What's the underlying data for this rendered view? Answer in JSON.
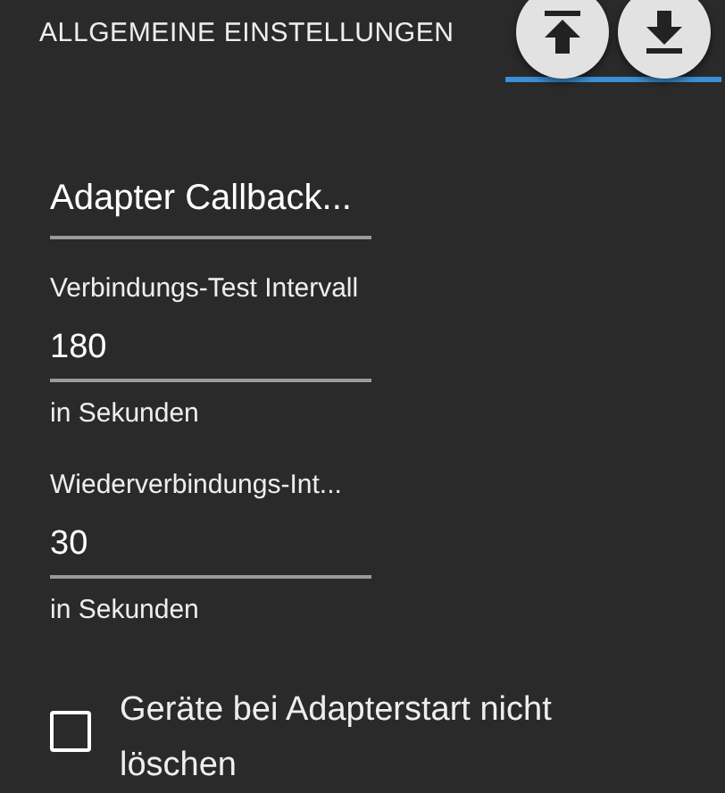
{
  "tabs": [
    {
      "label": "ALLGEMEINE EINSTELLUNGEN",
      "selected": false
    },
    {
      "selected": true
    }
  ],
  "header_buttons": [
    {
      "kind": "upload"
    },
    {
      "kind": "download"
    }
  ],
  "fields": [
    {
      "kind": "value_only",
      "value": "Adapter Callback..."
    },
    {
      "kind": "labeled",
      "label": "Verbindungs-Test Intervall",
      "value": "180",
      "helper": "in Sekunden"
    },
    {
      "kind": "labeled",
      "label": "Wiederverbindungs-Int...",
      "value": "30",
      "helper": "in Sekunden"
    }
  ],
  "checkbox": {
    "label": "Geräte bei Adapterstart nicht löschen",
    "checked": false
  }
}
